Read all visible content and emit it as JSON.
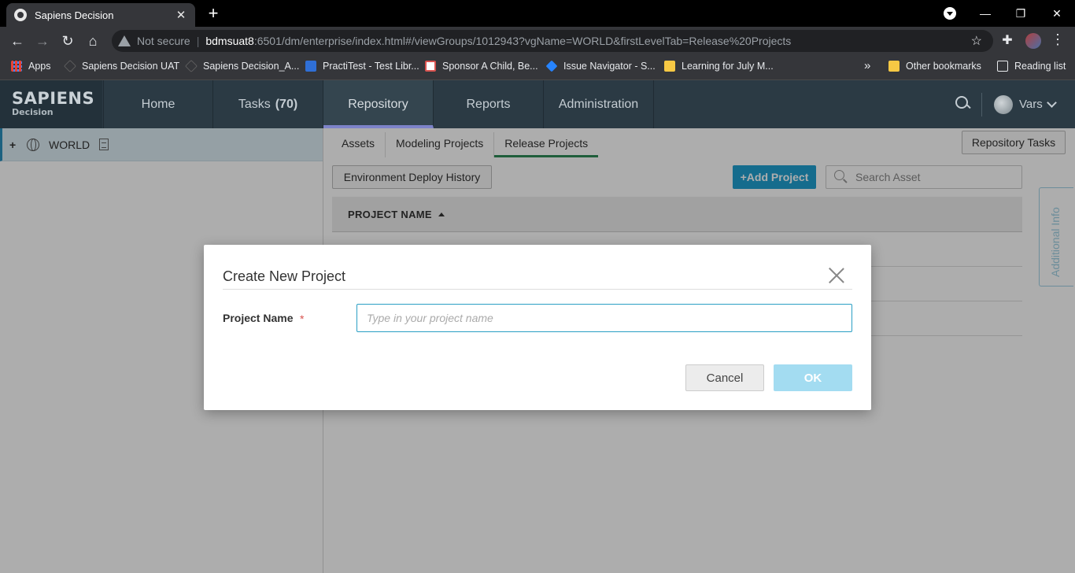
{
  "browser": {
    "tab_title": "Sapiens Decision",
    "tab_close": "✕",
    "new_tab": "+",
    "win_minimize": "—",
    "win_restore": "❐",
    "win_close": "✕",
    "back": "←",
    "forward": "→",
    "reload": "↻",
    "home": "⌂",
    "not_secure": "Not secure",
    "url_host": "bdmsuat8",
    "url_path": ":6501/dm/enterprise/index.html#/viewGroups/1012943?vgName=WORLD&firstLevelTab=Release%20Projects",
    "star": "☆",
    "ext": "✚",
    "menu": "⋮",
    "bookmarks": [
      {
        "label": "Apps",
        "icon": "apps-icon"
      },
      {
        "label": "Sapiens Decision UAT",
        "icon": "diamond-icon"
      },
      {
        "label": "Sapiens Decision_A...",
        "icon": "diamond-icon"
      },
      {
        "label": "PractiTest - Test Libr...",
        "icon": "practitest-icon"
      },
      {
        "label": "Sponsor A Child, Be...",
        "icon": "globe-icon"
      },
      {
        "label": "Issue Navigator - S...",
        "icon": "jira-icon"
      },
      {
        "label": "Learning for July M...",
        "icon": "bookmark-icon"
      }
    ],
    "more_bookmarks": "»",
    "other_bookmarks": "Other bookmarks",
    "reading_list": "Reading list"
  },
  "app": {
    "logo_line1": "SAPIENS",
    "logo_line2": "Decision",
    "nav": [
      {
        "label": "Home"
      },
      {
        "label": "Tasks",
        "count": "(70)"
      },
      {
        "label": "Repository"
      },
      {
        "label": "Reports"
      },
      {
        "label": "Administration"
      }
    ],
    "user": "Vars"
  },
  "tree": {
    "expander": "+",
    "root_label": "WORLD"
  },
  "content": {
    "subtabs": [
      "Assets",
      "Modeling Projects",
      "Release Projects"
    ],
    "active_subtab": "Release Projects",
    "repository_tasks": "Repository Tasks",
    "env_deploy_history": "Environment Deploy History",
    "add_project": "+Add Project",
    "search_placeholder": "Search Asset",
    "column_project_name": "PROJECT NAME",
    "side_tab": "Additional Info"
  },
  "modal": {
    "title": "Create New Project",
    "field_label": "Project Name",
    "required_mark": "*",
    "input_value": "",
    "input_placeholder": "Type in your project name",
    "cancel": "Cancel",
    "ok": "OK"
  },
  "colors": {
    "header_bg": "#2b3a44",
    "nav_active_underline": "#7d83c9",
    "primary_button": "#1f9fd0",
    "ok_disabled": "#a3dcf1",
    "active_subtab_underline": "#2e8b57"
  }
}
